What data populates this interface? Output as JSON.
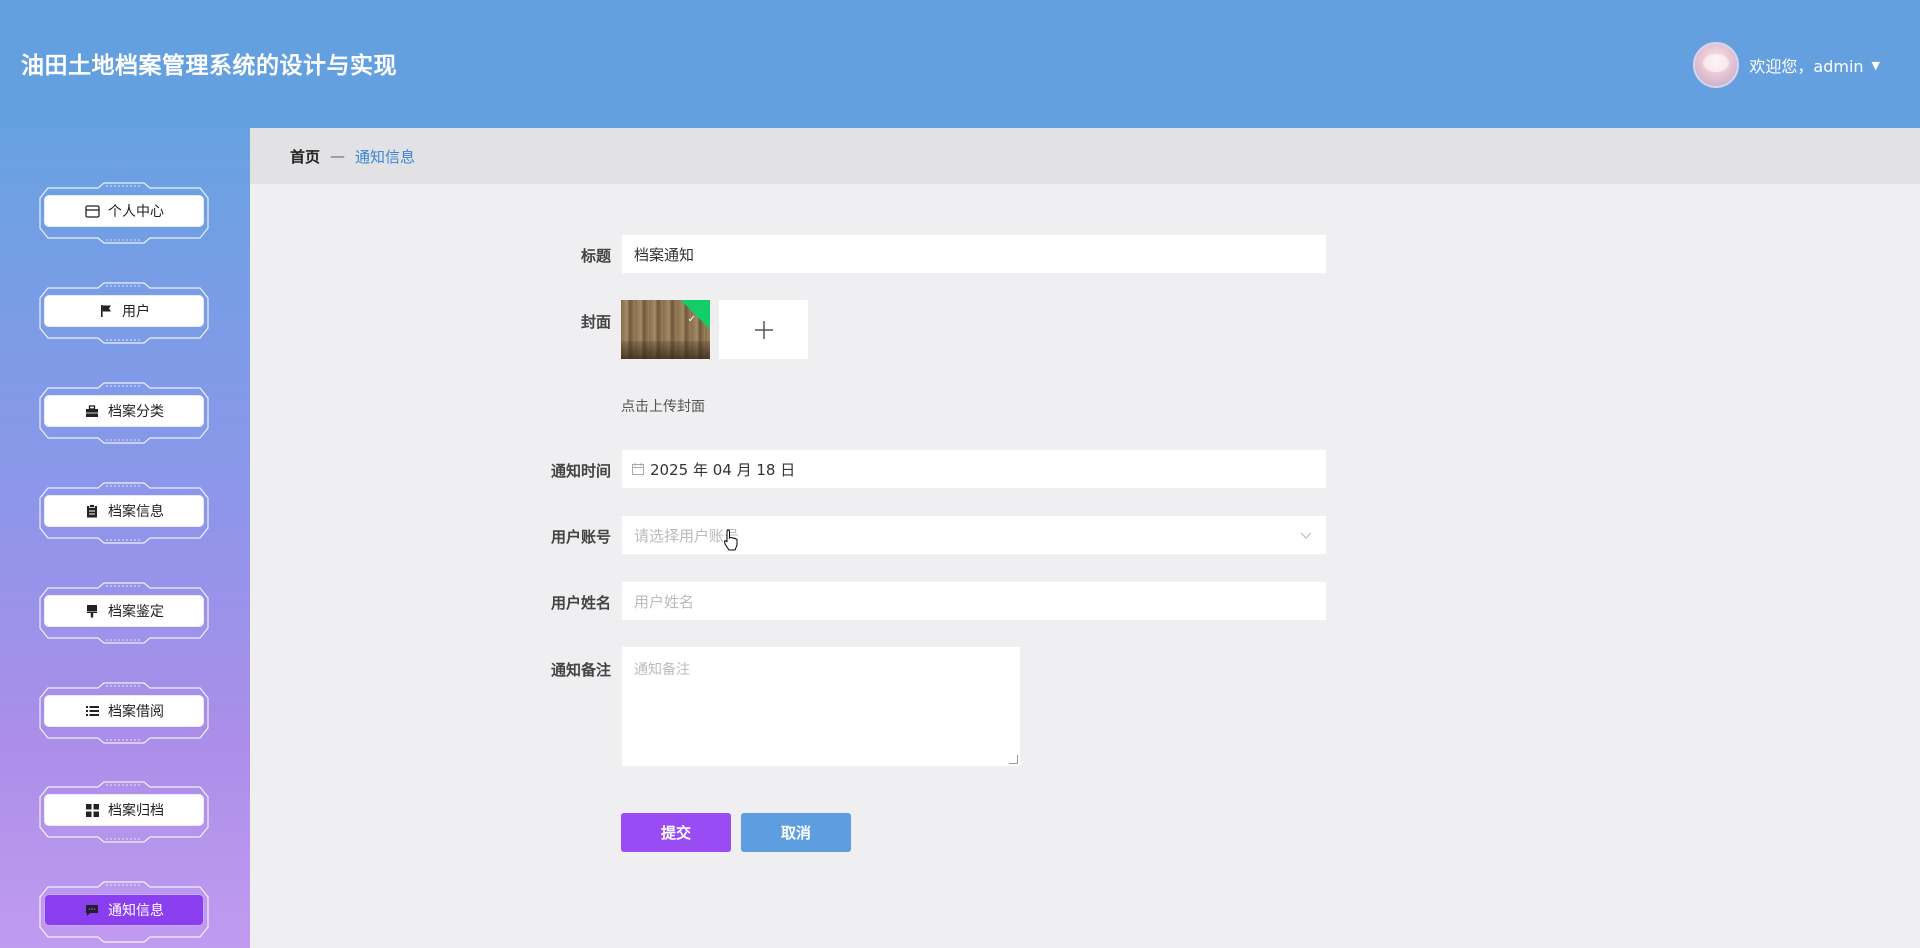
{
  "header": {
    "title": "油田土地档案管理系统的设计与实现",
    "welcome": "欢迎您，admin"
  },
  "sidebar": {
    "items": [
      {
        "label": "个人中心",
        "icon": "wallet-icon",
        "active": false
      },
      {
        "label": "用户",
        "icon": "flag-icon",
        "active": false
      },
      {
        "label": "档案分类",
        "icon": "briefcase-icon",
        "active": false
      },
      {
        "label": "档案信息",
        "icon": "clipboard-icon",
        "active": false
      },
      {
        "label": "档案鉴定",
        "icon": "brush-icon",
        "active": false
      },
      {
        "label": "档案借阅",
        "icon": "list-icon",
        "active": false
      },
      {
        "label": "档案归档",
        "icon": "grid-icon",
        "active": false
      },
      {
        "label": "通知信息",
        "icon": "message-icon",
        "active": true
      }
    ]
  },
  "breadcrumb": {
    "home": "首页",
    "separator": "—",
    "current": "通知信息"
  },
  "form": {
    "title_label": "标题",
    "title_value": "档案通知",
    "cover_label": "封面",
    "cover_hint": "点击上传封面",
    "time_label": "通知时间",
    "time_value": "2025 年 04 月 18 日",
    "account_label": "用户账号",
    "account_placeholder": "请选择用户账号",
    "name_label": "用户姓名",
    "name_placeholder": "用户姓名",
    "remark_label": "通知备注",
    "remark_placeholder": "通知备注",
    "submit_label": "提交",
    "cancel_label": "取消"
  },
  "colors": {
    "header_bg": "#64a0e0",
    "active_nav": "#8a3ef0",
    "submit": "#9a4cf4",
    "cancel": "#5d9ee0",
    "link": "#3d84d6"
  }
}
